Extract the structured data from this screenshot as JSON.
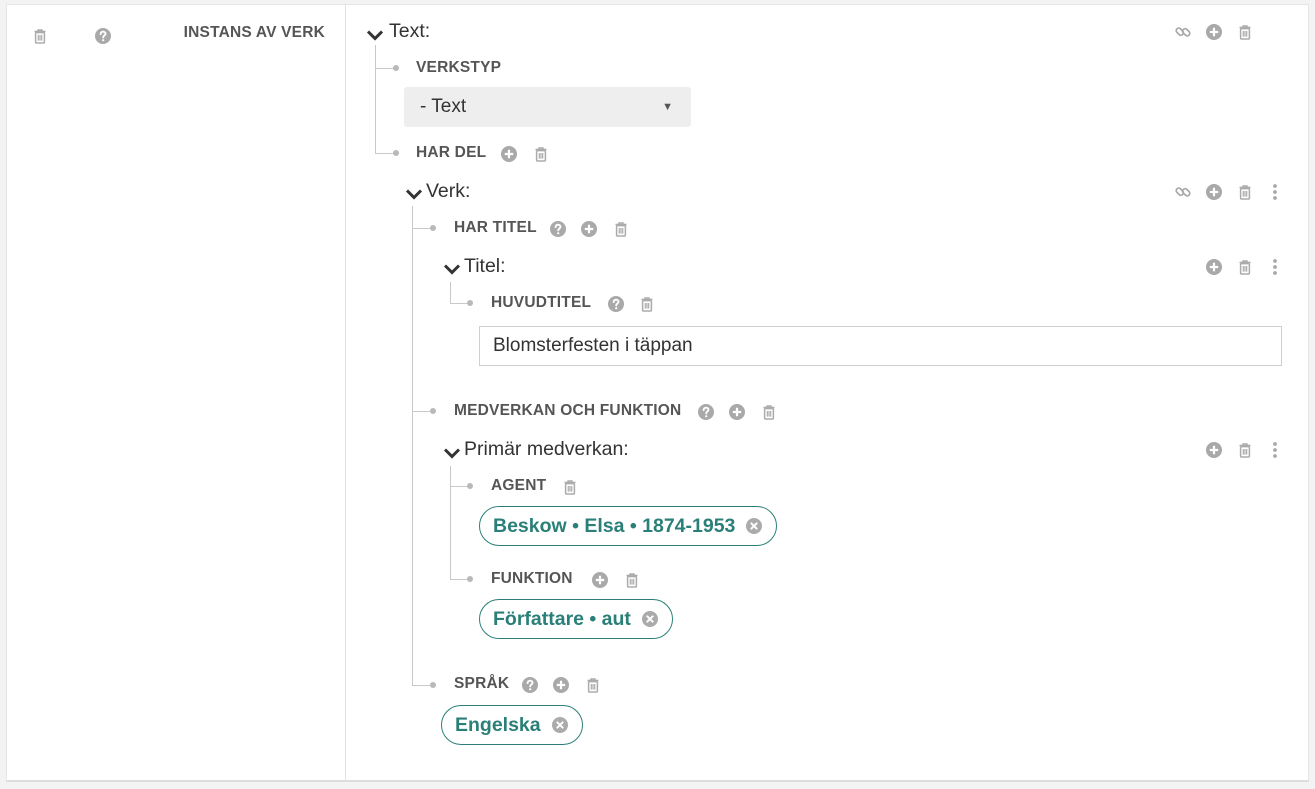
{
  "left_column": {
    "label": "INSTANS AV VERK"
  },
  "root": {
    "heading": "Text:",
    "verkstyp": {
      "label": "VERKSTYP",
      "selected": "- Text"
    },
    "har_del": {
      "label": "HAR DEL"
    }
  },
  "verk": {
    "heading": "Verk:",
    "har_titel": {
      "label": "HAR TITEL"
    },
    "titel": {
      "heading": "Titel:",
      "huvudtitel": {
        "label": "HUVUDTITEL",
        "value": "Blomsterfesten i täppan"
      }
    },
    "medverkan": {
      "label": "MEDVERKAN OCH FUNKTION",
      "primar": {
        "heading": "Primär medverkan:",
        "agent": {
          "label": "AGENT",
          "value": "Beskow • Elsa • 1874-1953"
        },
        "funktion": {
          "label": "FUNKTION",
          "value": "Författare • aut"
        }
      }
    },
    "sprak": {
      "label": "SPRÅK",
      "value": "Engelska"
    }
  },
  "colors": {
    "accent": "#2a7f78",
    "icon": "#a9a9a9",
    "connector": "#c9c9c9"
  }
}
